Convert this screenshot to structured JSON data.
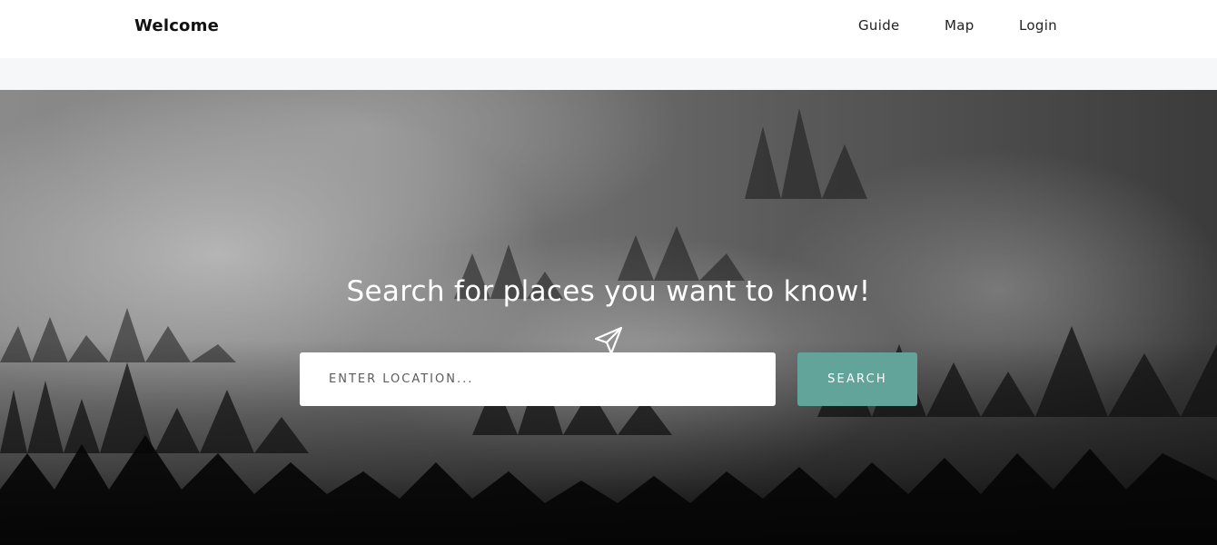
{
  "navbar": {
    "brand": "Welcome",
    "links": [
      "Guide",
      "Map",
      "Login"
    ]
  },
  "hero": {
    "icon": "paper-plane-icon",
    "title": "Search for places you want to know!",
    "search": {
      "placeholder": "ENTER LOCATION...",
      "value": "",
      "button_label": "SEARCH"
    }
  },
  "colors": {
    "accent": "#62a39a",
    "subbar": "#f6f7f9",
    "text_dark": "#111111"
  }
}
